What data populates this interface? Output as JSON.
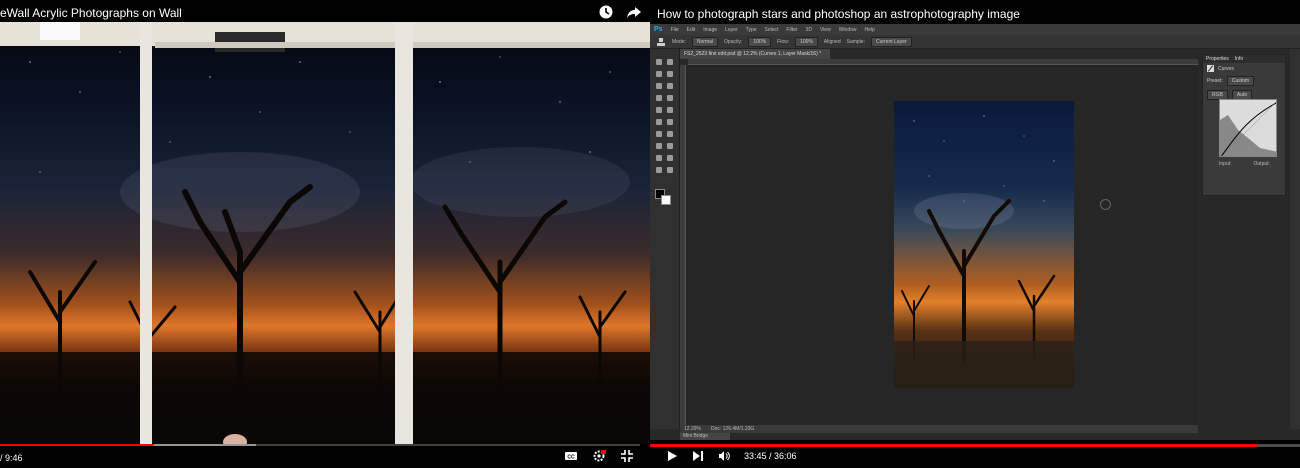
{
  "left_player": {
    "title": "eWall Acrylic Photographs on Wall",
    "time": "/ 9:46",
    "progress_fraction": 0.24,
    "buffered_fraction": 0.4,
    "icons": [
      "clock-icon",
      "share-icon",
      "cc-icon",
      "settings-icon",
      "fullscreen-exit-icon"
    ]
  },
  "right_player": {
    "title": "How to photograph stars and photoshop an astrophotography image",
    "time": "33:45 / 36:06",
    "progress_fraction": 0.935,
    "icons": [
      "play-icon",
      "next-icon",
      "volume-icon"
    ]
  },
  "photoshop": {
    "menu": [
      "File",
      "Edit",
      "Image",
      "Layer",
      "Type",
      "Select",
      "Filter",
      "3D",
      "View",
      "Window",
      "Help"
    ],
    "options": {
      "mode_label": "Mode:",
      "mode_value": "Normal",
      "opacity_label": "Opacity:",
      "opacity_value": "100%",
      "flow_label": "Flow:",
      "flow_value": "100%",
      "aligned_label": "Aligned",
      "sample_label": "Sample:",
      "sample_value": "Current Layer"
    },
    "doc_tab": "FS2_2523 first edit.psd @ 12.2% (Curves 1, Layer Mask/16) *",
    "status_zoom": "12.29%",
    "status_doc": "Doc: 126.4M/1.33G",
    "bottom_tab": "Mini Bridge",
    "panel": {
      "tabs": [
        "Properties",
        "Info"
      ],
      "adjustment": "Curves",
      "preset_label": "Preset:",
      "preset_value": "Custom",
      "channel_value": "RGB",
      "auto_label": "Auto",
      "input_label": "Input:",
      "output_label": "Output:"
    }
  },
  "colors": {
    "progress": "#ff0000",
    "ps_bg": "#282828",
    "ps_accent": "#31a8ff"
  }
}
